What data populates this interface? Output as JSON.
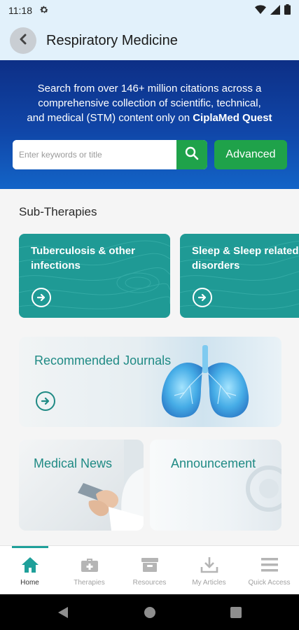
{
  "status": {
    "time": "11:18"
  },
  "header": {
    "title": "Respiratory Medicine"
  },
  "hero": {
    "line1": "Search from over 146+ million citations across a",
    "line2": "comprehensive collection of scientific, technical,",
    "line3_prefix": "and medical (STM) content only on ",
    "line3_brand": "CiplaMed Quest",
    "search_placeholder": "Enter keywords or title",
    "advanced_label": "Advanced"
  },
  "sub_therapies": {
    "title": "Sub-Therapies",
    "cards": [
      {
        "label": "Tuberculosis & other\ninfections"
      },
      {
        "label": "Sleep & Sleep related\ndisorders"
      }
    ]
  },
  "journals": {
    "label": "Recommended Journals"
  },
  "news": {
    "label": "Medical News"
  },
  "announcement": {
    "label": "Announcement"
  },
  "bottom_nav": {
    "items": [
      {
        "label": "Home",
        "icon": "home-icon",
        "active": true
      },
      {
        "label": "Therapies",
        "icon": "medical-bag-icon",
        "active": false
      },
      {
        "label": "Resources",
        "icon": "archive-box-icon",
        "active": false
      },
      {
        "label": "My Articles",
        "icon": "download-icon",
        "active": false
      },
      {
        "label": "Quick Access",
        "icon": "menu-icon",
        "active": false
      }
    ]
  },
  "colors": {
    "brand_teal": "#1f9a95",
    "accent_green": "#1fa24a",
    "hero_blue": "#0d2f86",
    "header_bg": "#e2f1fb"
  }
}
